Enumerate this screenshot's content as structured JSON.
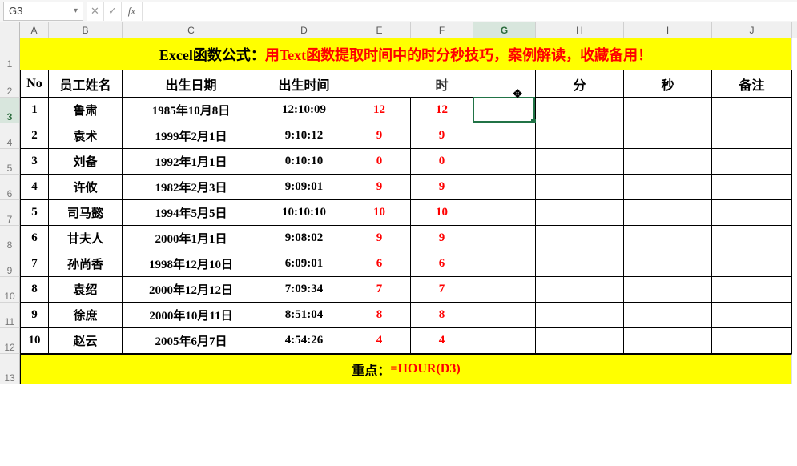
{
  "formula_bar": {
    "name_box": "G3",
    "cancel": "✕",
    "confirm": "✓",
    "fx": "fx",
    "formula": ""
  },
  "columns": [
    "A",
    "B",
    "C",
    "D",
    "E",
    "F",
    "G",
    "H",
    "I",
    "J"
  ],
  "title": {
    "lead": "Excel函数公式：",
    "body": "用Text函数提取时间中的时分秒技巧，案例解读，收藏备用！"
  },
  "headers": {
    "no": "No",
    "name": "员工姓名",
    "birth_date": "出生日期",
    "birth_time": "出生时间",
    "hour": "时",
    "minute": "分",
    "second": "秒",
    "remark": "备注"
  },
  "rows": [
    {
      "no": "1",
      "name": "鲁肃",
      "date": "1985年10月8日",
      "time": "12:10:09",
      "e": "12",
      "f": "12"
    },
    {
      "no": "2",
      "name": "袁术",
      "date": "1999年2月1日",
      "time": "9:10:12",
      "e": "9",
      "f": "9"
    },
    {
      "no": "3",
      "name": "刘备",
      "date": "1992年1月1日",
      "time": "0:10:10",
      "e": "0",
      "f": "0"
    },
    {
      "no": "4",
      "name": "许攸",
      "date": "1982年2月3日",
      "time": "9:09:01",
      "e": "9",
      "f": "9"
    },
    {
      "no": "5",
      "name": "司马懿",
      "date": "1994年5月5日",
      "time": "10:10:10",
      "e": "10",
      "f": "10"
    },
    {
      "no": "6",
      "name": "甘夫人",
      "date": "2000年1月1日",
      "time": "9:08:02",
      "e": "9",
      "f": "9"
    },
    {
      "no": "7",
      "name": "孙尚香",
      "date": "1998年12月10日",
      "time": "6:09:01",
      "e": "6",
      "f": "6"
    },
    {
      "no": "8",
      "name": "袁绍",
      "date": "2000年12月12日",
      "time": "7:09:34",
      "e": "7",
      "f": "7"
    },
    {
      "no": "9",
      "name": "徐庶",
      "date": "2000年10月11日",
      "time": "8:51:04",
      "e": "8",
      "f": "8"
    },
    {
      "no": "10",
      "name": "赵云",
      "date": "2005年6月7日",
      "time": "4:54:26",
      "e": "4",
      "f": "4"
    }
  ],
  "footer": {
    "lead": "重点：",
    "formula": "=HOUR(D3)"
  },
  "active_cell": "G3",
  "cursor_glyph": "✥"
}
